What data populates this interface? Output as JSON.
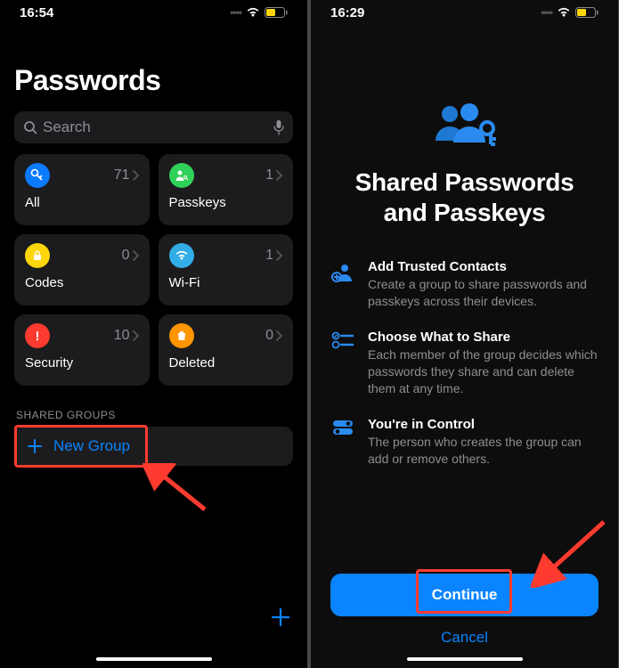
{
  "left": {
    "time": "16:54",
    "title": "Passwords",
    "search_placeholder": "Search",
    "tiles": {
      "all": {
        "label": "All",
        "count": "71",
        "color": "#0a7aff"
      },
      "passkeys": {
        "label": "Passkeys",
        "count": "1",
        "color": "#30d158"
      },
      "codes": {
        "label": "Codes",
        "count": "0",
        "color": "#ffd60a"
      },
      "wifi": {
        "label": "Wi-Fi",
        "count": "1",
        "color": "#32ade6"
      },
      "security": {
        "label": "Security",
        "count": "10",
        "color": "#ff3b30"
      },
      "deleted": {
        "label": "Deleted",
        "count": "0",
        "color": "#ff9500"
      }
    },
    "shared_header": "SHARED GROUPS",
    "new_group": "New Group"
  },
  "right": {
    "time": "16:29",
    "title": "Shared Passwords and Passkeys",
    "features": {
      "a": {
        "title": "Add Trusted Contacts",
        "desc": "Create a group to share passwords and passkeys across their devices."
      },
      "b": {
        "title": "Choose What to Share",
        "desc": "Each member of the group decides which passwords they share and can delete them at any time."
      },
      "c": {
        "title": "You're in Control",
        "desc": "The person who creates the group can add or remove others."
      }
    },
    "continue": "Continue",
    "cancel": "Cancel"
  }
}
